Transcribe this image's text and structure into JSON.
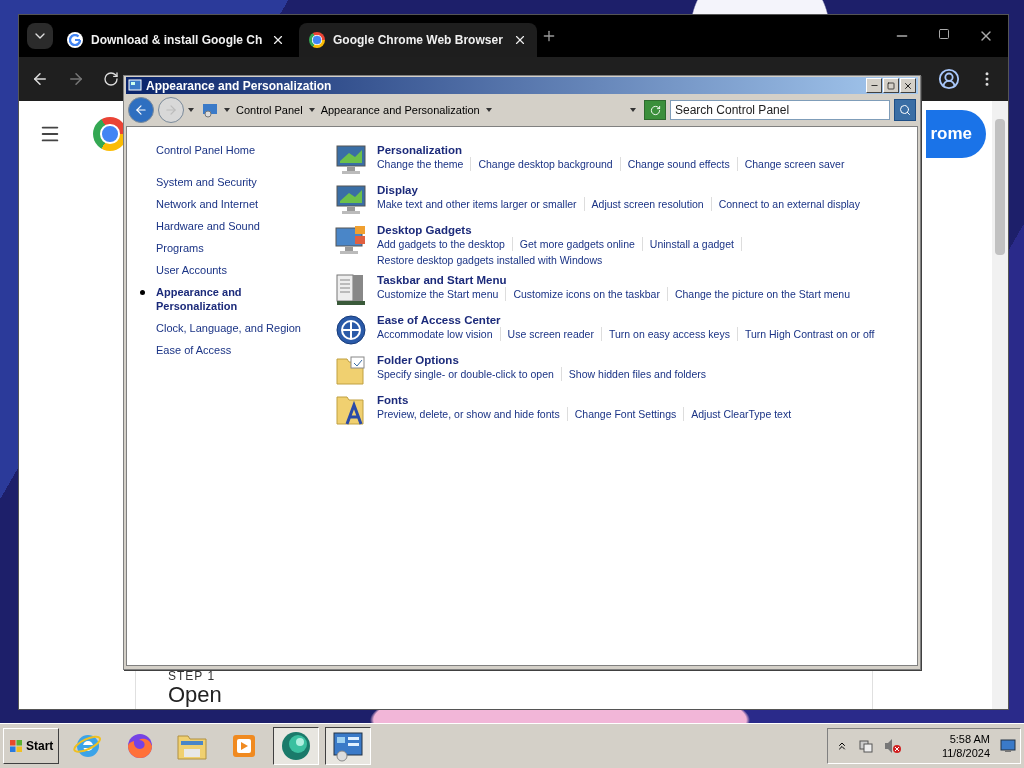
{
  "browser": {
    "tabs": [
      {
        "title": "Download & install Google Ch",
        "selected": false
      },
      {
        "title": "Google Chrome Web Browser",
        "selected": true
      }
    ],
    "page": {
      "button": "rome",
      "step_label": "STEP 1",
      "heading": "Open"
    }
  },
  "control_panel": {
    "title": "Appearance and Personalization",
    "breadcrumb": [
      "Control Panel",
      "Appearance and Personalization"
    ],
    "search": {
      "placeholder": "Search Control Panel"
    },
    "nav": [
      {
        "label": "Control Panel Home",
        "kind": "home",
        "selected": false
      },
      {
        "label": "System and Security",
        "kind": "category",
        "selected": false
      },
      {
        "label": "Network and Internet",
        "kind": "category",
        "selected": false
      },
      {
        "label": "Hardware and Sound",
        "kind": "category",
        "selected": false
      },
      {
        "label": "Programs",
        "kind": "category",
        "selected": false
      },
      {
        "label": "User Accounts",
        "kind": "category",
        "selected": false
      },
      {
        "label": "Appearance and Personalization",
        "kind": "category",
        "selected": true
      },
      {
        "label": "Clock, Language, and Region",
        "kind": "category",
        "selected": false
      },
      {
        "label": "Ease of Access",
        "kind": "category",
        "selected": false
      }
    ],
    "categories": [
      {
        "kind": "monitor",
        "title": "Personalization",
        "links": [
          "Change the theme",
          "Change desktop background",
          "Change sound effects",
          "Change screen saver"
        ]
      },
      {
        "kind": "monitor",
        "title": "Display",
        "links": [
          "Make text and other items larger or smaller",
          "Adjust screen resolution",
          "Connect to an external display"
        ]
      },
      {
        "kind": "gadgets",
        "title": "Desktop Gadgets",
        "links": [
          "Add gadgets to the desktop",
          "Get more gadgets online",
          "Uninstall a gadget",
          "Restore desktop gadgets installed with Windows"
        ]
      },
      {
        "kind": "taskbar",
        "title": "Taskbar and Start Menu",
        "links": [
          "Customize the Start menu",
          "Customize icons on the taskbar",
          "Change the picture on the Start menu"
        ]
      },
      {
        "kind": "access",
        "title": "Ease of Access Center",
        "links": [
          "Accommodate low vision",
          "Use screen reader",
          "Turn on easy access keys",
          "Turn High Contrast on or off"
        ]
      },
      {
        "kind": "folder",
        "title": "Folder Options",
        "links": [
          "Specify single- or double-click to open",
          "Show hidden files and folders"
        ]
      },
      {
        "kind": "fonts",
        "title": "Fonts",
        "links": [
          "Preview, delete, or show and hide fonts",
          "Change Font Settings",
          "Adjust ClearType text"
        ]
      }
    ]
  },
  "taskbar": {
    "start": "Start",
    "apps": [
      {
        "kind": "ie",
        "selected": false
      },
      {
        "kind": "firefox",
        "selected": false
      },
      {
        "kind": "explorer",
        "selected": false
      },
      {
        "kind": "media",
        "selected": false
      },
      {
        "kind": "sphere",
        "selected": true
      },
      {
        "kind": "control",
        "selected": true
      }
    ],
    "clock": {
      "time": "5:58 AM",
      "date": "11/8/2024"
    }
  }
}
